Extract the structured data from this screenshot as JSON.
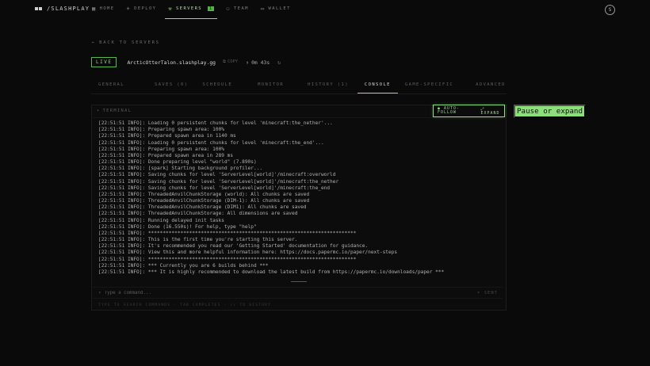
{
  "app": {
    "brand": "/SLASHPLAY"
  },
  "nav": {
    "items": [
      {
        "label": "HOME",
        "icon": "grid-icon"
      },
      {
        "label": "DEPLOY",
        "icon": "plus-icon"
      },
      {
        "label": "SERVERS",
        "icon": "wrench-icon",
        "badge": "1"
      },
      {
        "label": "TEAM",
        "icon": "users-icon"
      },
      {
        "label": "WALLET",
        "icon": "wallet-icon"
      }
    ],
    "active": "SERVERS",
    "avatar": "S"
  },
  "server": {
    "back_label": "BACK TO SERVERS",
    "status": "LIVE",
    "host": "ArcticOtterTalon.slashplay.gg",
    "copy_label": "COPY",
    "uptime": "0m 43s"
  },
  "tabs": [
    {
      "label": "GENERAL"
    },
    {
      "label": "SAVES (0)"
    },
    {
      "label": "SCHEDULE"
    },
    {
      "label": "MONITOR"
    },
    {
      "label": "HISTORY (1)"
    },
    {
      "label": "CONSOLE"
    },
    {
      "label": "GAME-SPECIFIC"
    },
    {
      "label": "ADVANCED"
    }
  ],
  "active_tab": "CONSOLE",
  "terminal": {
    "title": "TERMINAL",
    "auto_follow": "AUTO-FOLLOW",
    "expand": "EXPAND",
    "lines": [
      "[22:51:51 INFO]: Loading 0 persistent chunks for level 'minecraft:the_nether'...",
      "[22:51:51 INFO]: Preparing spawn area: 100%",
      "[22:51:51 INFO]: Prepared spawn area in 1140 ms",
      "[22:51:51 INFO]: Loading 0 persistent chunks for level 'minecraft:the_end'...",
      "[22:51:51 INFO]: Preparing spawn area: 100%",
      "[22:51:51 INFO]: Prepared spawn area in 289 ms",
      "[22:51:51 INFO]: Done preparing level \"world\" (7.890s)",
      "[22:51:51 INFO]: [spark] Starting background profiler...",
      "[22:51:51 INFO]: Saving chunks for level 'ServerLevel[world]'/minecraft:overworld",
      "[22:51:51 INFO]: Saving chunks for level 'ServerLevel[world]'/minecraft:the_nether",
      "[22:51:51 INFO]: Saving chunks for level 'ServerLevel[world]'/minecraft:the_end",
      "[22:51:51 INFO]: ThreadedAnvilChunkStorage (world): All chunks are saved",
      "[22:51:51 INFO]: ThreadedAnvilChunkStorage (DIM-1): All chunks are saved",
      "[22:51:51 INFO]: ThreadedAnvilChunkStorage (DIM1): All chunks are saved",
      "[22:51:51 INFO]: ThreadedAnvilChunkStorage: All dimensions are saved",
      "[22:51:51 INFO]: Running delayed init tasks",
      "[22:51:51 INFO]: Done (16.550s)! For help, type \"help\"",
      "[22:51:51 INFO]: ***********************************************************************",
      "[22:51:51 INFO]: This is the first time you're starting this server.",
      "[22:51:51 INFO]: It's recommended you read our 'Getting Started' documentation for guidance.",
      "[22:51:51 INFO]: View this and more helpful information here: https://docs.papermc.io/paper/next-steps",
      "[22:51:51 INFO]: ***********************************************************************",
      "[22:51:51 INFO]: *** Currently you are 6 builds behind ***",
      "[22:51:51 INFO]: *** It is highly recommended to download the latest build from https://papermc.io/downloads/paper ***"
    ],
    "command_placeholder": "Type a command...",
    "send_label": "SENT",
    "hint": "TYPE TO SEARCH COMMANDS · TAB COMPLETES · ↑↓ TO HISTORY"
  },
  "pause_button": "Pause or expand",
  "colors": {
    "accent": "#8be07a",
    "background": "#0a0a0a"
  }
}
